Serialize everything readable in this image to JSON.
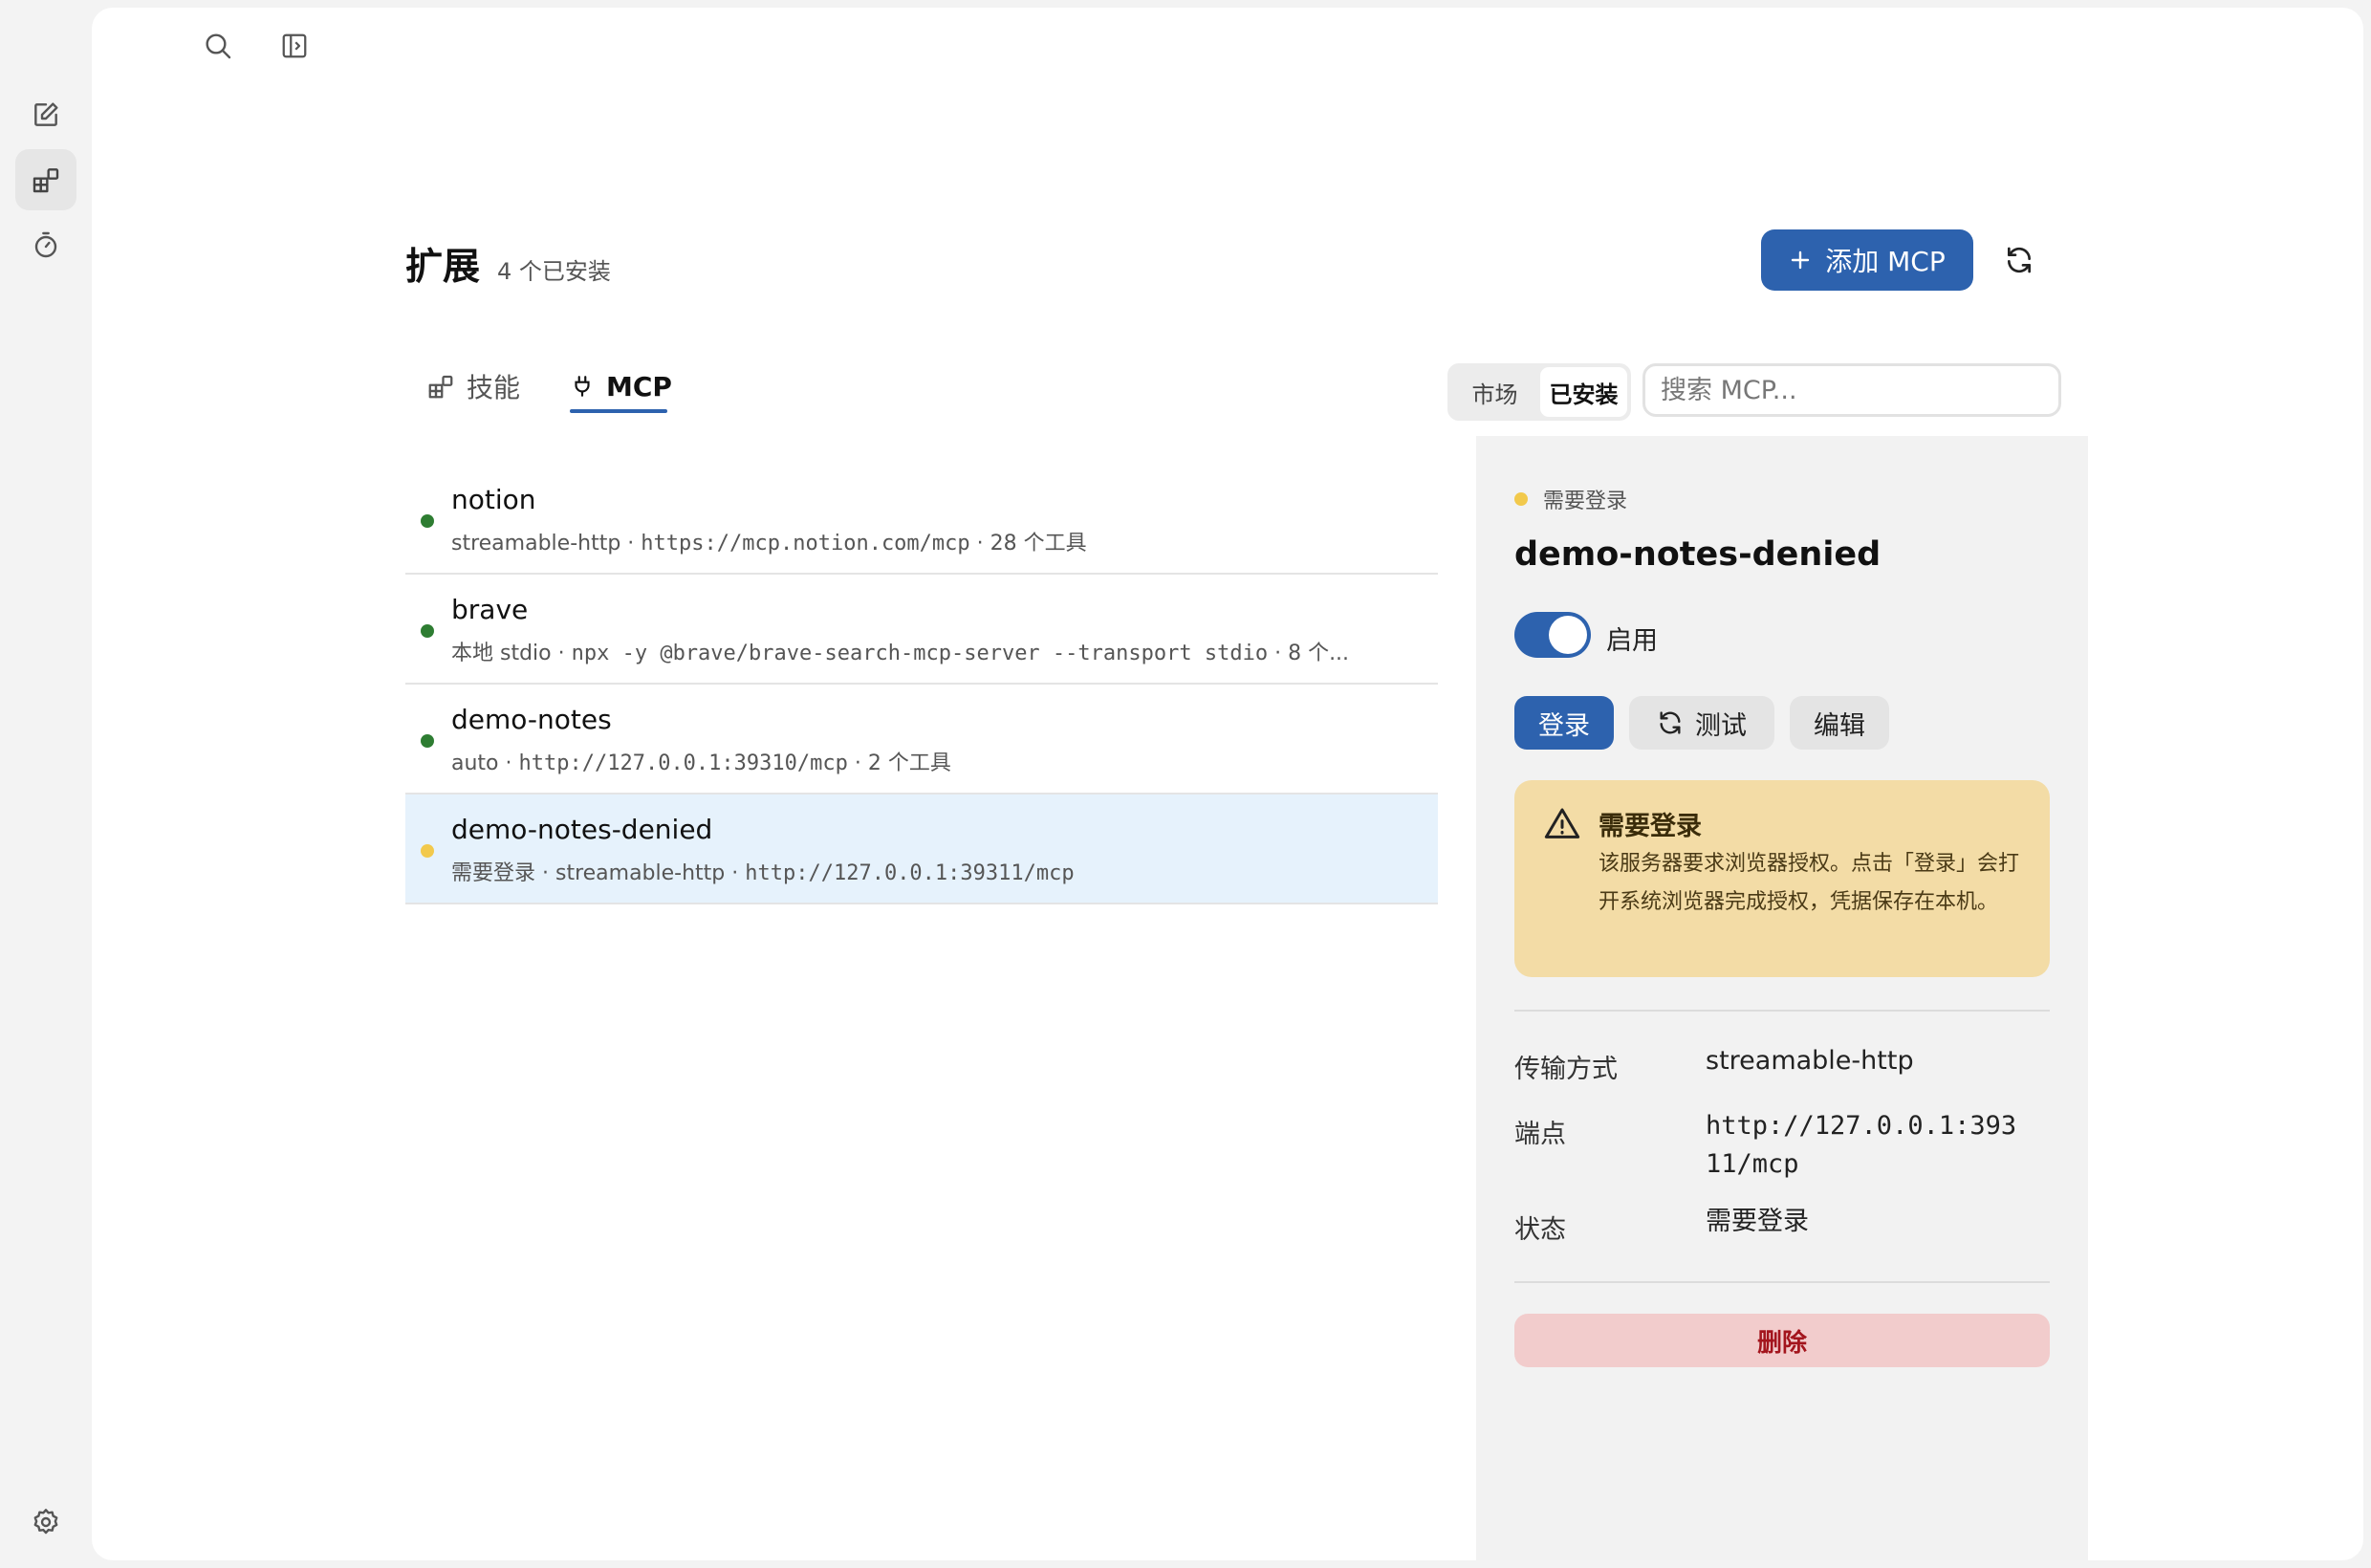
{
  "header": {
    "title": "扩展",
    "installed_count": "4 个已安装",
    "add_button_label": "添加 MCP"
  },
  "tabs": [
    {
      "label": "技能",
      "active": false
    },
    {
      "label": "MCP",
      "active": true
    }
  ],
  "segment": {
    "options": [
      "市场",
      "已安装"
    ],
    "selected": "已安装"
  },
  "search": {
    "placeholder": "搜索 MCP..."
  },
  "servers": [
    {
      "name": "notion",
      "status": "ok",
      "subtitle_prefix": "streamable-http · ",
      "subtitle_mono": "https://mcp.notion.com/mcp",
      "subtitle_suffix": " · 28 个工具"
    },
    {
      "name": "brave",
      "status": "ok",
      "subtitle_prefix": "本地 stdio · ",
      "subtitle_mono": "npx -y @brave/brave-search-mcp-server --transport stdio",
      "subtitle_suffix": " · 8 个..."
    },
    {
      "name": "demo-notes",
      "status": "ok",
      "subtitle_prefix": "auto · ",
      "subtitle_mono": "http://127.0.0.1:39310/mcp",
      "subtitle_suffix": " · 2 个工具"
    },
    {
      "name": "demo-notes-denied",
      "status": "warn",
      "subtitle_prefix": "需要登录 · streamable-http · ",
      "subtitle_mono": "http://127.0.0.1:39311/mcp",
      "subtitle_suffix": ""
    }
  ],
  "detail": {
    "status_label": "需要登录",
    "name": "demo-notes-denied",
    "enabled": true,
    "enabled_label": "启用",
    "login_label": "登录",
    "test_label": "测试",
    "edit_label": "编辑",
    "warning_title": "需要登录",
    "warning_body": "该服务器要求浏览器授权。点击「登录」会打开系统浏览器完成授权，凭据保存在本机。",
    "transport_key": "传输方式",
    "transport_value": "streamable-http",
    "endpoint_key": "端点",
    "endpoint_value": "http://127.0.0.1:39311/mcp",
    "state_key": "状态",
    "state_value": "需要登录",
    "delete_label": "删除"
  },
  "colors": {
    "accent": "#2d62ae",
    "status_ok": "#2e7d32",
    "status_warn": "#f2c94c",
    "warning_bg": "#f3dca6",
    "danger_bg": "#f2cccc",
    "danger_text": "#a3151d",
    "selected_row_bg": "#e6f2fc"
  },
  "icons": {
    "rail": [
      "new-chat-icon",
      "extensions-icon",
      "timer-icon",
      "settings-icon"
    ],
    "top": [
      "search-icon",
      "sidebar-toggle-icon"
    ]
  }
}
